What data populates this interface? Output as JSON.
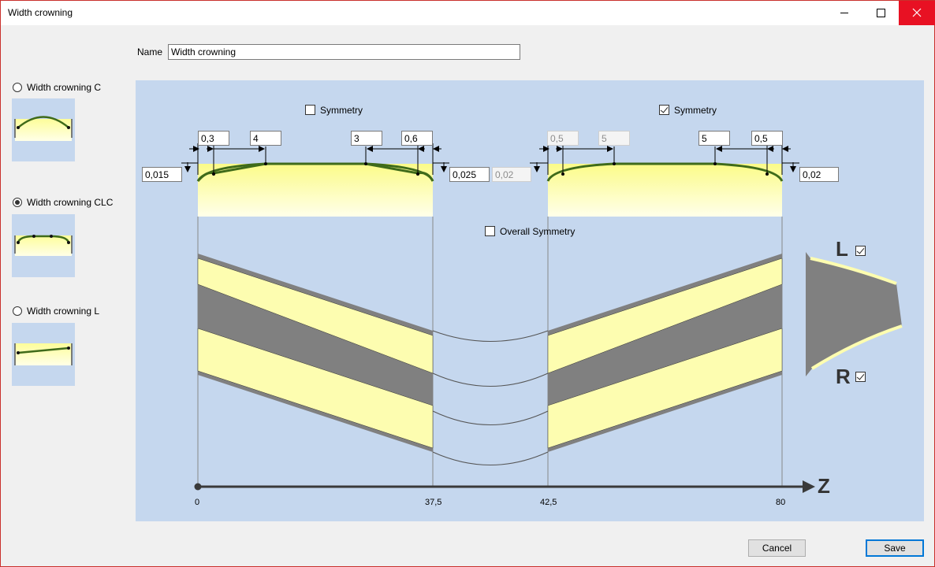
{
  "window": {
    "title": "Width crowning"
  },
  "name_field": {
    "label": "Name",
    "value": "Width crowning"
  },
  "options": [
    {
      "label": "Width crowning C",
      "selected": false
    },
    {
      "label": "Width crowning CLC",
      "selected": true
    },
    {
      "label": "Width crowning L",
      "selected": false
    }
  ],
  "left_section": {
    "symmetry_label": "Symmetry",
    "symmetry_checked": false,
    "left_width": "0,3",
    "left_transition": "4",
    "right_transition": "3",
    "right_width": "0,6",
    "left_height": "0,015",
    "right_height": "0,025"
  },
  "right_section": {
    "symmetry_label": "Symmetry",
    "symmetry_checked": true,
    "left_width": "0,5",
    "left_transition": "5",
    "right_transition": "5",
    "right_width": "0,5",
    "left_height": "0,02",
    "right_height": "0,02"
  },
  "overall_symmetry": {
    "label": "Overall Symmetry",
    "checked": false
  },
  "flanks": {
    "left_label": "L",
    "left_checked": true,
    "right_label": "R",
    "right_checked": true
  },
  "axis": {
    "label": "Z",
    "ticks": [
      "0",
      "37,5",
      "42,5",
      "80"
    ]
  },
  "buttons": {
    "cancel": "Cancel",
    "save": "Save"
  },
  "colors": {
    "panel": "#c5d7ee",
    "crowning_line": "#3f6b1a",
    "gear_face": "#fdfdb0",
    "gear_gray": "#808080",
    "close": "#e81123"
  }
}
